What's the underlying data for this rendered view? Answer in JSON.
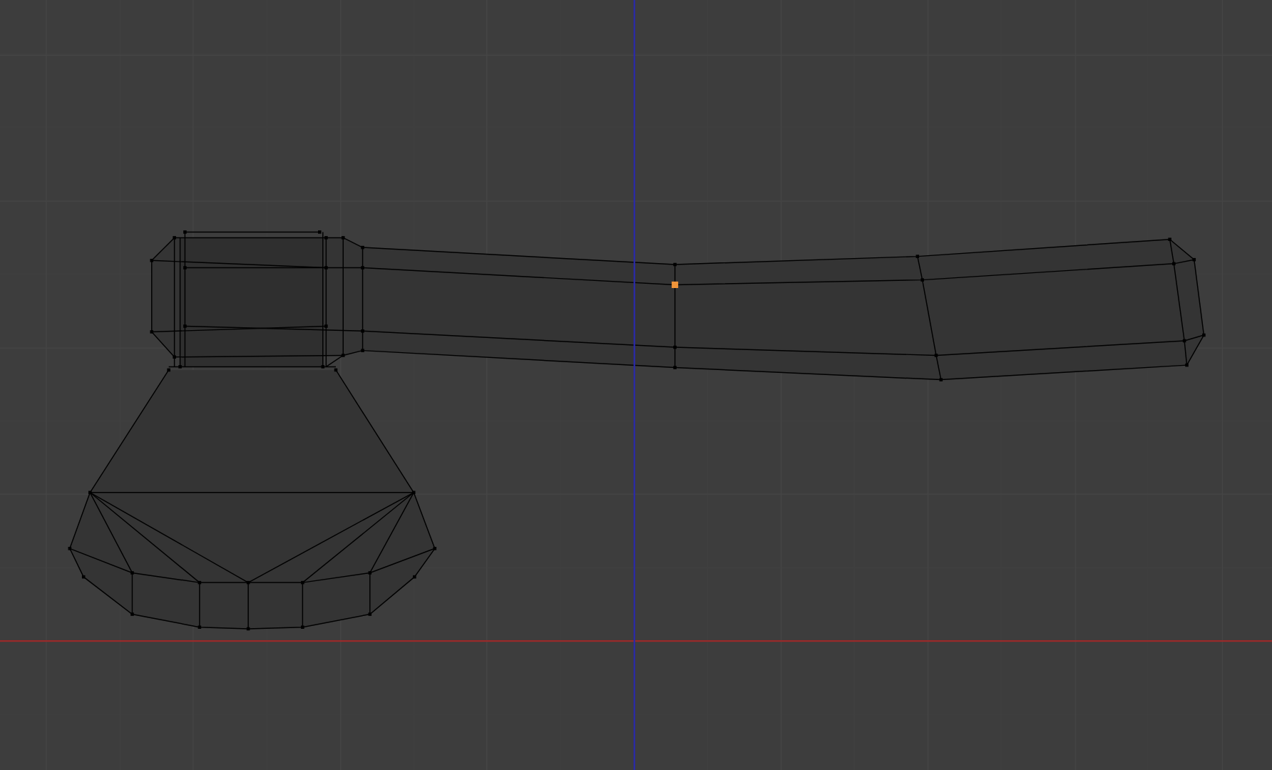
{
  "viewport": {
    "kind": "mesh-wireframe",
    "axes": [
      {
        "kind": "horizontal",
        "color": "#9a2a2a"
      },
      {
        "kind": "vertical",
        "color": "#2a2aa8"
      }
    ]
  }
}
